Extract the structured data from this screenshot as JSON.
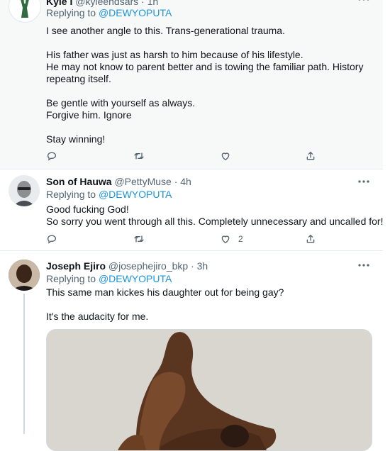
{
  "tweets": [
    {
      "name": "Kyle I",
      "handle": "@kyleendsars · 1h",
      "replying_prefix": "Replying to ",
      "replying_to": "@DEWYOPUTA",
      "lines": [
        "I see another angle to this. Trans-generational trauma.",
        "",
        "His father was just as harsh to him because of his lifestyle.",
        "He may not know to parent better and is towing the familiar path. History",
        "repeatng itself.",
        "",
        "Be gentle with yourself as always.",
        "Forgive him. Ignore",
        "",
        "Stay winning!"
      ],
      "like_count": ""
    },
    {
      "name": "Son of Hauwa",
      "handle": "@PettyMuse · 4h",
      "replying_prefix": "Replying to ",
      "replying_to": "@DEWYOPUTA",
      "lines": [
        "Good fucking God!",
        "So sorry you went through all this. Completely unnecessary and uncalled for!"
      ],
      "like_count": "2"
    },
    {
      "name": "Joseph Ejiro",
      "handle": "@josephejiro_bkp · 3h",
      "replying_prefix": "Replying to ",
      "replying_to": "@DEWYOPUTA",
      "lines": [
        "This same man kickes his daughter out for being gay?",
        "",
        "It's the audacity for me."
      ]
    }
  ],
  "icons": {
    "reply": "reply-icon",
    "retweet": "retweet-icon",
    "like": "heart-icon",
    "share": "share-icon",
    "more": "more-icon"
  },
  "colors": {
    "link": "#1b95e0",
    "secondary_text": "#536471",
    "highlight_background": "#f7f9f9",
    "divider": "#e6ecf0"
  }
}
